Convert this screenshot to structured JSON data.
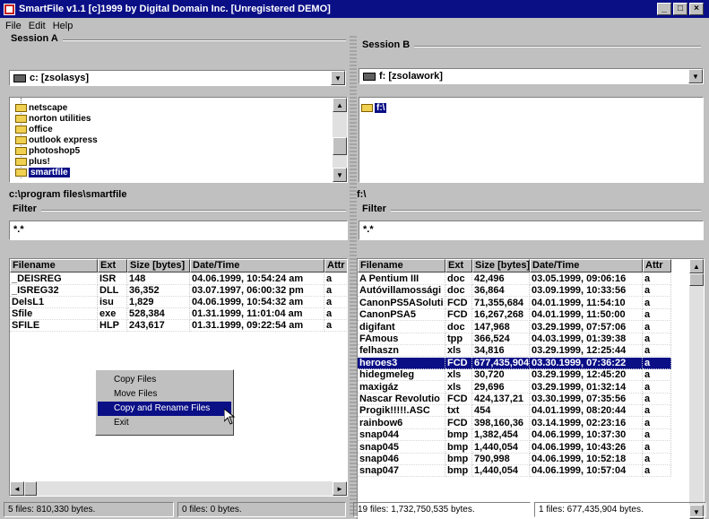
{
  "window": {
    "title": "SmartFile v1.1   [c]1999 by Digital Domain Inc. [Unregistered DEMO]"
  },
  "menu": [
    "File",
    "Edit",
    "Help"
  ],
  "session_a": {
    "label": "Session A",
    "drive": "c: [zsolasys]",
    "tree": [
      "netscape",
      "norton utilities",
      "office",
      "outlook express",
      "photoshop5",
      "plus!",
      "smartfile"
    ],
    "selected_tree": "smartfile",
    "path": "c:\\program files\\smartfile",
    "filter_label": "Filter",
    "filter_value": "*.*",
    "columns": [
      "Filename",
      "Ext",
      "Size [bytes]",
      "Date/Time",
      "Attr"
    ],
    "files": [
      {
        "name": "_DEISREG",
        "ext": "ISR",
        "size": "148",
        "date": "04.06.1999, 10:54:24 am",
        "attr": "a"
      },
      {
        "name": "_ISREG32",
        "ext": "DLL",
        "size": "36,352",
        "date": "03.07.1997, 06:00:32 pm",
        "attr": "a"
      },
      {
        "name": "DelsL1",
        "ext": "isu",
        "size": "1,829",
        "date": "04.06.1999, 10:54:32 am",
        "attr": "a"
      },
      {
        "name": "Sfile",
        "ext": "exe",
        "size": "528,384",
        "date": "01.31.1999, 11:01:04 am",
        "attr": "a"
      },
      {
        "name": "SFILE",
        "ext": "HLP",
        "size": "243,617",
        "date": "01.31.1999, 09:22:54 am",
        "attr": "a"
      }
    ],
    "status_left": "5 files: 810,330 bytes.",
    "status_right": "0 files: 0 bytes."
  },
  "session_b": {
    "label": "Session B",
    "drive": "f: [zsolawork]",
    "tree": [
      "f:\\"
    ],
    "path": "f:\\",
    "filter_label": "Filter",
    "filter_value": "*.*",
    "columns": [
      "Filename",
      "Ext",
      "Size [bytes]",
      "Date/Time",
      "Attr"
    ],
    "files": [
      {
        "name": "A Pentium III",
        "ext": "doc",
        "size": "42,496",
        "date": "03.05.1999, 09:06:16",
        "attr": "a"
      },
      {
        "name": "Autóvillamossági",
        "ext": "doc",
        "size": "36,864",
        "date": "03.09.1999, 10:33:56",
        "attr": "a"
      },
      {
        "name": "CanonPS5ASoluti",
        "ext": "FCD",
        "size": "71,355,684",
        "date": "04.01.1999, 11:54:10",
        "attr": "a"
      },
      {
        "name": "CanonPSA5",
        "ext": "FCD",
        "size": "16,267,268",
        "date": "04.01.1999, 11:50:00",
        "attr": "a"
      },
      {
        "name": "digifant",
        "ext": "doc",
        "size": "147,968",
        "date": "03.29.1999, 07:57:06",
        "attr": "a"
      },
      {
        "name": "FAmous",
        "ext": "tpp",
        "size": "366,524",
        "date": "04.03.1999, 01:39:38",
        "attr": "a"
      },
      {
        "name": "felhaszn",
        "ext": "xls",
        "size": "34,816",
        "date": "03.29.1999, 12:25:44",
        "attr": "a"
      },
      {
        "name": "heroes3",
        "ext": "FCD",
        "size": "677,435,904",
        "date": "03.30.1999, 07:36:22",
        "attr": "a"
      },
      {
        "name": "hidegmeleg",
        "ext": "xls",
        "size": "30,720",
        "date": "03.29.1999, 12:45:20",
        "attr": "a"
      },
      {
        "name": "maxigáz",
        "ext": "xls",
        "size": "29,696",
        "date": "03.29.1999, 01:32:14",
        "attr": "a"
      },
      {
        "name": "Nascar Revolutio",
        "ext": "FCD",
        "size": "424,137,21",
        "date": "03.30.1999, 07:35:56",
        "attr": "a"
      },
      {
        "name": "Progik!!!!!.ASC",
        "ext": "txt",
        "size": "454",
        "date": "04.01.1999, 08:20:44",
        "attr": "a"
      },
      {
        "name": "rainbow6",
        "ext": "FCD",
        "size": "398,160,36",
        "date": "03.14.1999, 02:23:16",
        "attr": "a"
      },
      {
        "name": "snap044",
        "ext": "bmp",
        "size": "1,382,454",
        "date": "04.06.1999, 10:37:30",
        "attr": "a"
      },
      {
        "name": "snap045",
        "ext": "bmp",
        "size": "1,440,054",
        "date": "04.06.1999, 10:43:26",
        "attr": "a"
      },
      {
        "name": "snap046",
        "ext": "bmp",
        "size": "790,998",
        "date": "04.06.1999, 10:52:18",
        "attr": "a"
      },
      {
        "name": "snap047",
        "ext": "bmp",
        "size": "1,440,054",
        "date": "04.06.1999, 10:57:04",
        "attr": "a"
      }
    ],
    "selected_file": "heroes3",
    "status_left": "19 files: 1,732,750,535 bytes.",
    "status_right": "1 files: 677,435,904 bytes."
  },
  "context_menu": {
    "items": [
      "Copy Files",
      "Move Files",
      "Copy and Rename Files",
      "Exit"
    ],
    "highlighted": "Copy and Rename Files"
  },
  "colors": {
    "titlebar": "#0a0f86",
    "selection": "#0a0f86",
    "face": "#c0c0c0"
  }
}
